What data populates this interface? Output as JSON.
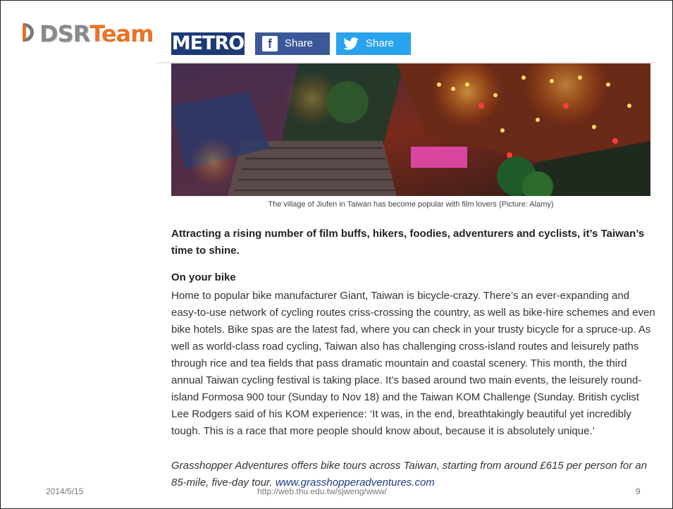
{
  "logo": {
    "text_dsr": "DSR",
    "text_team": "Team"
  },
  "header": {
    "metro": "METRO",
    "share_facebook": "Share",
    "share_twitter": "Share",
    "icons": {
      "facebook": "facebook-icon",
      "twitter": "twitter-icon"
    }
  },
  "photo": {
    "caption": "The village of Jiufen in Taiwan has become popular with film lovers (Picture: Alamy)"
  },
  "article": {
    "lead": "Attracting a rising number of film buffs, hikers, foodies, adventurers and cyclists, it’s Taiwan’s time to shine.",
    "section_title": "On your bike",
    "body": "Home to popular bike manufacturer Giant, Taiwan is bicycle-crazy. There’s an ever-expanding and easy-to-use network of cycling routes criss-crossing the country, as well as bike-hire schemes and even bike hotels. Bike spas are the latest fad, where you can check in your trusty bicycle for a spruce-up. As well as world-class road cycling, Taiwan also has challenging cross-island routes and leisurely paths through rice and tea fields that pass dramatic mountain and coastal scenery. This month, the third annual Taiwan cycling festival is taking place. It’s based around two main events, the leisurely round-island Formosa 900 tour (Sunday to Nov 18) and the Taiwan KOM Challenge (Sunday. British cyclist Lee Rodgers said of his KOM experience: ‘It was, in the end, breathtakingly beautiful yet incredibly tough. This is a race that more people should know about, because it is absolutely unique.’",
    "promo_text": "Grasshopper Adventures offers bike tours across Taiwan, starting from around £615 per person for an 85-mile, five-day tour. ",
    "promo_link": "www.grasshopperadventures.com"
  },
  "footer": {
    "date": "2014/5/15",
    "url": "http://web.thu.edu.tw/sjweng/www/",
    "page": "9"
  },
  "colors": {
    "metro": "#1c3a78",
    "facebook": "#3b5998",
    "twitter": "#2aa3ef",
    "logo_orange": "#e8742a"
  }
}
